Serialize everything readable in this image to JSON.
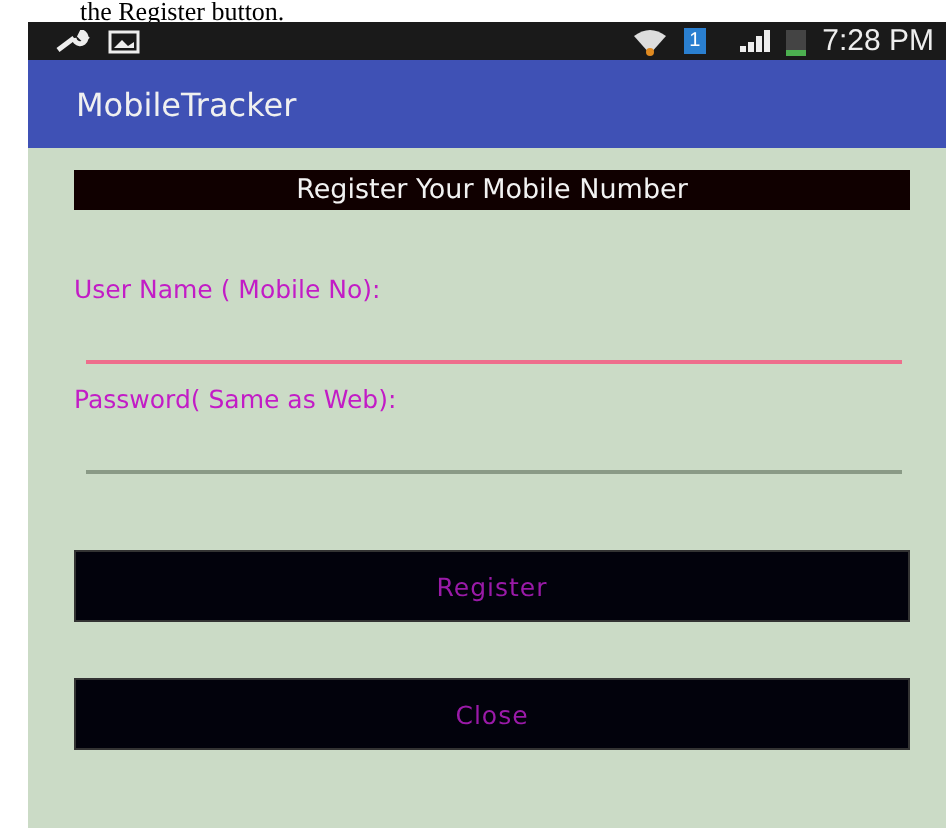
{
  "caption": "the Register button.",
  "status_bar": {
    "sim_badge": "1",
    "time": "7:28 PM"
  },
  "app_bar": {
    "title": "MobileTracker"
  },
  "form": {
    "heading": "Register Your Mobile Number",
    "fields": [
      {
        "label": "User Name ( Mobile No):",
        "focused": true
      },
      {
        "label": "Password( Same as Web):",
        "focused": false
      }
    ],
    "buttons": [
      "Register",
      "Close"
    ]
  }
}
